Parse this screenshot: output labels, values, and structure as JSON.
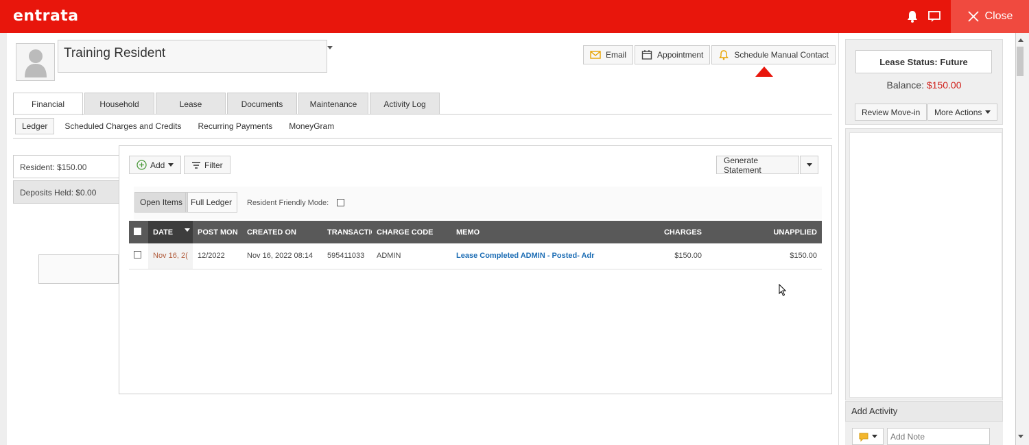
{
  "topbar": {
    "logo": "entrata",
    "close_label": "Close",
    "accent_color": "#e8160c"
  },
  "resident": {
    "name": "Training Resident"
  },
  "header_actions": [
    {
      "label": "Email",
      "icon": "mail-icon"
    },
    {
      "label": "Appointment",
      "icon": "calendar-icon"
    },
    {
      "label": "Schedule Manual Contact",
      "icon": "bell-icon"
    }
  ],
  "tabs": [
    "Financial",
    "Household",
    "Lease",
    "Documents",
    "Maintenance",
    "Activity Log"
  ],
  "active_tab": "Financial",
  "subtabs": [
    "Ledger",
    "Scheduled Charges and Credits",
    "Recurring Payments",
    "MoneyGram"
  ],
  "active_subtab": "Ledger",
  "side": {
    "resident_balance": "Resident: $150.00",
    "deposits_held": "Deposits Held: $0.00"
  },
  "ledger": {
    "add_label": "Add",
    "filter_label": "Filter",
    "generate_label": "Generate Statement",
    "open_items_label": "Open Items",
    "full_ledger_label": "Full Ledger",
    "resident_friendly_label": "Resident Friendly Mode:",
    "columns": [
      "DATE",
      "POST MON",
      "CREATED ON",
      "TRANSACTIC",
      "CHARGE CODE",
      "MEMO",
      "CHARGES",
      "UNAPPLIED"
    ],
    "rows": [
      {
        "date": "Nov 16, 2(",
        "post_month": "12/2022",
        "created_on": "Nov 16, 2022 08:14",
        "transaction": "595411033",
        "charge_code": "ADMIN",
        "memo": "Lease Completed ADMIN - Posted- Adr",
        "charges": "$150.00",
        "unapplied": "$150.00"
      }
    ]
  },
  "right_panel": {
    "lease_status": "Lease Status: Future",
    "balance_label": "Balance:",
    "balance_amount": "$150.00",
    "review_label": "Review Move-in",
    "more_actions_label": "More Actions",
    "add_activity_label": "Add Activity",
    "add_note_placeholder": "Add Note"
  }
}
